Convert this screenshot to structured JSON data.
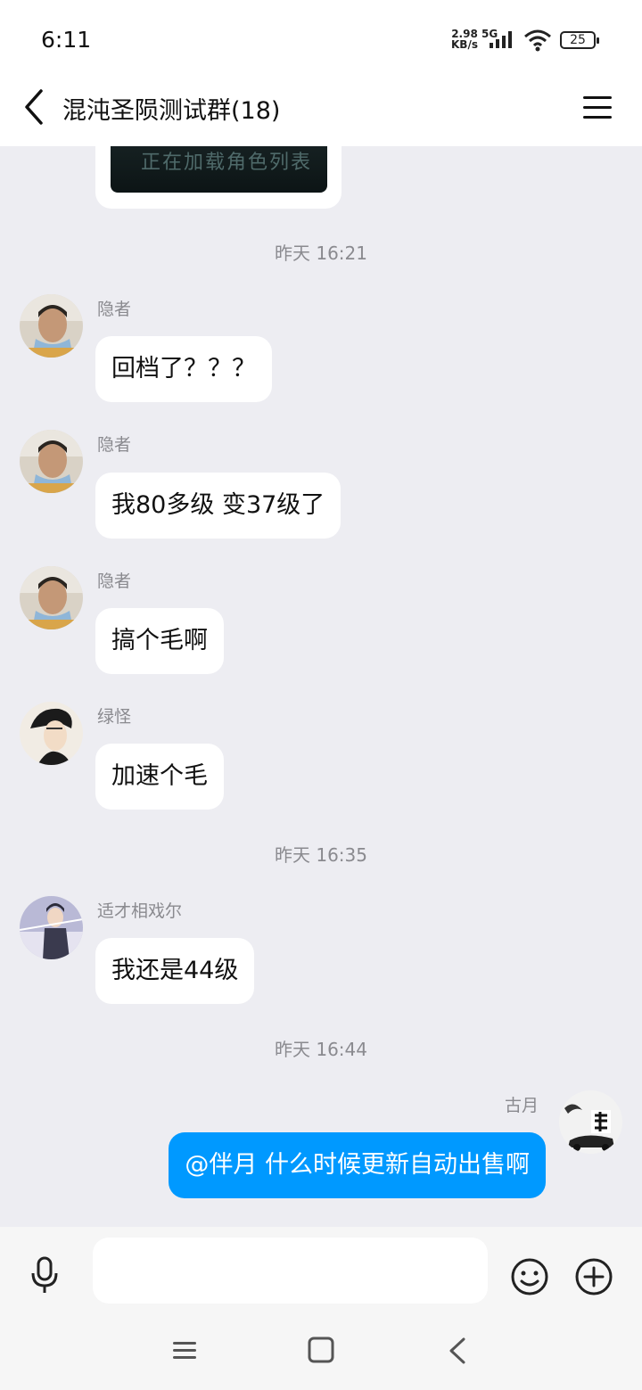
{
  "status_bar": {
    "time": "6:11",
    "net_speed_value": "2.98",
    "net_speed_unit": "KB/s",
    "network_type": "5G",
    "battery": "25",
    "icons": [
      "signal-icon",
      "wifi-icon",
      "battery-icon"
    ]
  },
  "header": {
    "title": "混沌圣陨测试群(18)",
    "icons": [
      "back-icon",
      "menu-icon"
    ]
  },
  "image_message": {
    "thumb_text": "正在加载角色列表"
  },
  "messages": [
    {
      "type": "timestamp",
      "text": "昨天 16:21"
    },
    {
      "type": "incoming",
      "sender": "隐者",
      "text": "回档了？？？"
    },
    {
      "type": "incoming",
      "sender": "隐者",
      "text": "我80多级 变37级了"
    },
    {
      "type": "incoming",
      "sender": "隐者",
      "text": "搞个毛啊"
    },
    {
      "type": "incoming",
      "sender": "绿怪",
      "text": "加速个毛"
    },
    {
      "type": "timestamp",
      "text": "昨天 16:35"
    },
    {
      "type": "incoming",
      "sender": "适才相戏尔",
      "text": "我还是44级"
    },
    {
      "type": "timestamp",
      "text": "昨天 16:44"
    },
    {
      "type": "outgoing",
      "sender": "古月",
      "text": "@伴月 什么时候更新自动出售啊"
    }
  ],
  "input_bar": {
    "placeholder": "",
    "icons": [
      "microphone-icon",
      "emoji-icon",
      "plus-icon"
    ]
  },
  "nav_bar": {
    "icons": [
      "nav-menu-icon",
      "nav-home-icon",
      "nav-back-icon"
    ]
  },
  "colors": {
    "background": "#ededf2",
    "self_bubble": "#0099ff",
    "incoming_bubble": "#ffffff"
  }
}
